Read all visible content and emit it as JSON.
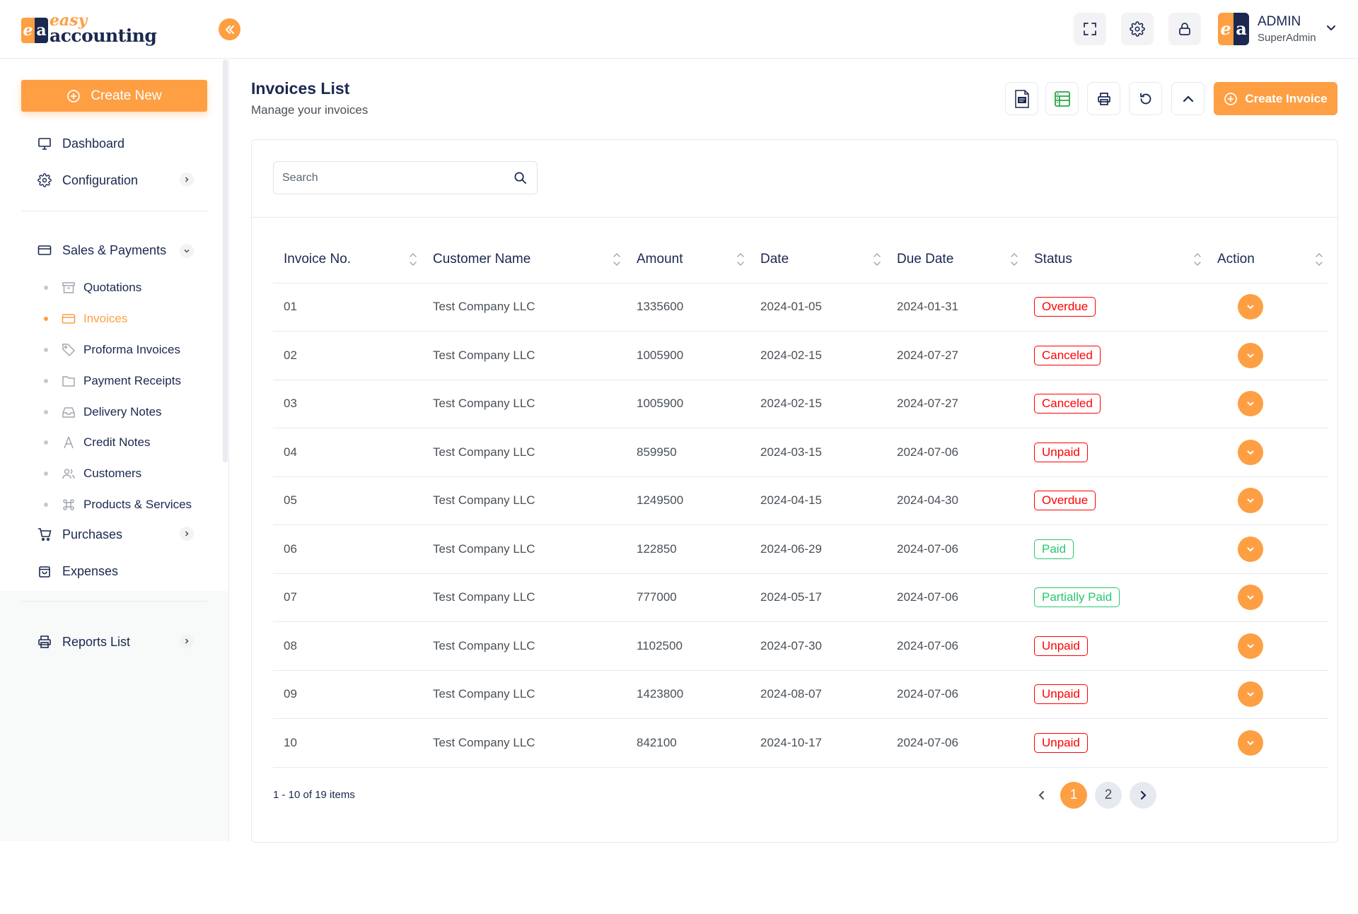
{
  "brand": {
    "logo_mark_e": "e",
    "logo_mark_a": "a",
    "word_top": "easy",
    "word_bottom": "accounting"
  },
  "user": {
    "name": "ADMIN",
    "role": "SuperAdmin",
    "avatar_e": "e",
    "avatar_a": "a"
  },
  "header_icons": [
    "fullscreen-icon",
    "settings-icon",
    "lock-icon"
  ],
  "sidebar": {
    "create_new": "Create New",
    "items": [
      {
        "label": "Dashboard",
        "icon": "monitor-icon"
      },
      {
        "label": "Configuration",
        "icon": "gear-icon"
      },
      {
        "label": "Sales & Payments",
        "icon": "credit-card-icon"
      },
      {
        "label": "Purchases",
        "icon": "cart-icon"
      },
      {
        "label": "Expenses",
        "icon": "bag-icon"
      },
      {
        "label": "Reports List",
        "icon": "printer-icon"
      }
    ],
    "sub_items": [
      {
        "label": "Quotations",
        "icon": "archive-icon"
      },
      {
        "label": "Invoices",
        "icon": "card-icon"
      },
      {
        "label": "Proforma Invoices",
        "icon": "tag-icon"
      },
      {
        "label": "Payment Receipts",
        "icon": "folder-icon"
      },
      {
        "label": "Delivery Notes",
        "icon": "inbox-icon"
      },
      {
        "label": "Credit Notes",
        "icon": "compass-icon"
      },
      {
        "label": "Customers",
        "icon": "users-icon"
      },
      {
        "label": "Products & Services",
        "icon": "command-icon"
      }
    ],
    "active_sub": "Invoices"
  },
  "page": {
    "title": "Invoices List",
    "subtitle": "Manage your invoices",
    "create_button": "Create Invoice"
  },
  "search": {
    "placeholder": "Search"
  },
  "table": {
    "columns": [
      "Invoice No.",
      "Customer Name",
      "Amount",
      "Date",
      "Due Date",
      "Status",
      "Action"
    ],
    "rows": [
      {
        "no": "01",
        "customer": "Test Company LLC",
        "amount": "1335600",
        "date": "2024-01-05",
        "due": "2024-01-31",
        "status": "Overdue"
      },
      {
        "no": "02",
        "customer": "Test Company LLC",
        "amount": "1005900",
        "date": "2024-02-15",
        "due": "2024-07-27",
        "status": "Canceled"
      },
      {
        "no": "03",
        "customer": "Test Company LLC",
        "amount": "1005900",
        "date": "2024-02-15",
        "due": "2024-07-27",
        "status": "Canceled"
      },
      {
        "no": "04",
        "customer": "Test Company LLC",
        "amount": "859950",
        "date": "2024-03-15",
        "due": "2024-07-06",
        "status": "Unpaid"
      },
      {
        "no": "05",
        "customer": "Test Company LLC",
        "amount": "1249500",
        "date": "2024-04-15",
        "due": "2024-04-30",
        "status": "Overdue"
      },
      {
        "no": "06",
        "customer": "Test Company LLC",
        "amount": "122850",
        "date": "2024-06-29",
        "due": "2024-07-06",
        "status": "Paid"
      },
      {
        "no": "07",
        "customer": "Test Company LLC",
        "amount": "777000",
        "date": "2024-05-17",
        "due": "2024-07-06",
        "status": "Partially Paid"
      },
      {
        "no": "08",
        "customer": "Test Company LLC",
        "amount": "1102500",
        "date": "2024-07-30",
        "due": "2024-07-06",
        "status": "Unpaid"
      },
      {
        "no": "09",
        "customer": "Test Company LLC",
        "amount": "1423800",
        "date": "2024-08-07",
        "due": "2024-07-06",
        "status": "Unpaid"
      },
      {
        "no": "10",
        "customer": "Test Company LLC",
        "amount": "842100",
        "date": "2024-10-17",
        "due": "2024-07-06",
        "status": "Unpaid"
      }
    ]
  },
  "pagination": {
    "info": "1 - 10 of 19 items",
    "pages": [
      "1",
      "2"
    ],
    "current": "1"
  },
  "colors": {
    "accent": "#fe9f43",
    "navy": "#1b2850",
    "danger": "#ff0000",
    "success": "#28c76f"
  }
}
